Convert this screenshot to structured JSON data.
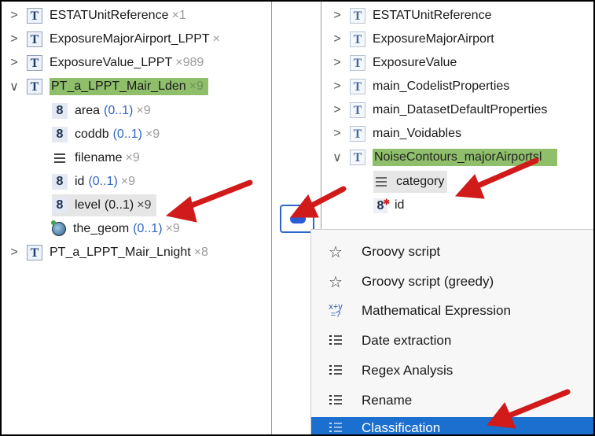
{
  "source_tree": {
    "items": [
      {
        "chevron": ">",
        "icon": "T",
        "name": "ESTATUnitReference",
        "card": "",
        "count": "×1"
      },
      {
        "chevron": ">",
        "icon": "T",
        "name": "ExposureMajorAirport_LPPT",
        "card": "",
        "count": "×"
      },
      {
        "chevron": ">",
        "icon": "T",
        "name": "ExposureValue_LPPT",
        "card": "",
        "count": "×989"
      },
      {
        "chevron": "∨",
        "icon": "T",
        "name": "PT_a_LPPT_Mair_Lden",
        "card": "",
        "count": "×9"
      },
      {
        "chevron": "",
        "icon": "8",
        "name": "area",
        "card": "(0..1)",
        "count": "×9"
      },
      {
        "chevron": "",
        "icon": "8",
        "name": "coddb",
        "card": "(0..1)",
        "count": "×9"
      },
      {
        "chevron": "",
        "icon": "string-icon",
        "name": "filename",
        "card": "",
        "count": "×9"
      },
      {
        "chevron": "",
        "icon": "8",
        "name": "id",
        "card": "(0..1)",
        "count": "×9"
      },
      {
        "chevron": "",
        "icon": "8",
        "name": "level",
        "card": "(0..1)",
        "count": "×9"
      },
      {
        "chevron": "",
        "icon": "geometry-icon",
        "name": "the_geom",
        "card": "(0..1)",
        "count": "×9"
      },
      {
        "chevron": ">",
        "icon": "T",
        "name": "PT_a_LPPT_Mair_Lnight",
        "card": "",
        "count": "×8"
      }
    ]
  },
  "target_tree": {
    "items": [
      {
        "chevron": ">",
        "icon": "T",
        "name": "ESTATUnitReference"
      },
      {
        "chevron": ">",
        "icon": "T",
        "name": "ExposureMajorAirport"
      },
      {
        "chevron": ">",
        "icon": "T",
        "name": "ExposureValue"
      },
      {
        "chevron": ">",
        "icon": "T",
        "name": "main_CodelistProperties"
      },
      {
        "chevron": ">",
        "icon": "T",
        "name": "main_DatasetDefaultProperties"
      },
      {
        "chevron": ">",
        "icon": "T",
        "name": "main_Voidables"
      },
      {
        "chevron": "∨",
        "icon": "T",
        "name": "NoiseContours_majorAirportsl"
      },
      {
        "chevron": "",
        "icon": "string-icon",
        "name": "category"
      },
      {
        "chevron": "",
        "icon": "8",
        "name": "id"
      }
    ]
  },
  "function_button": {
    "icon": "function-wizard-icon"
  },
  "function_menu": {
    "items": [
      {
        "icon": "star-outline-icon",
        "label": "Groovy script"
      },
      {
        "icon": "star-outline-icon",
        "label": "Groovy script (greedy)"
      },
      {
        "icon": "math-expression-icon",
        "label": "Mathematical Expression"
      },
      {
        "icon": "list-icon",
        "label": "Date extraction"
      },
      {
        "icon": "list-icon",
        "label": "Regex Analysis"
      },
      {
        "icon": "list-icon",
        "label": "Rename"
      },
      {
        "icon": "list-icon",
        "label": "Classification"
      }
    ],
    "selected": "Classification"
  },
  "colors": {
    "highlight_selected_type": "#8fbf6b",
    "menu_selection": "#1b6fcf",
    "annotation_arrow": "#d11a1a"
  }
}
